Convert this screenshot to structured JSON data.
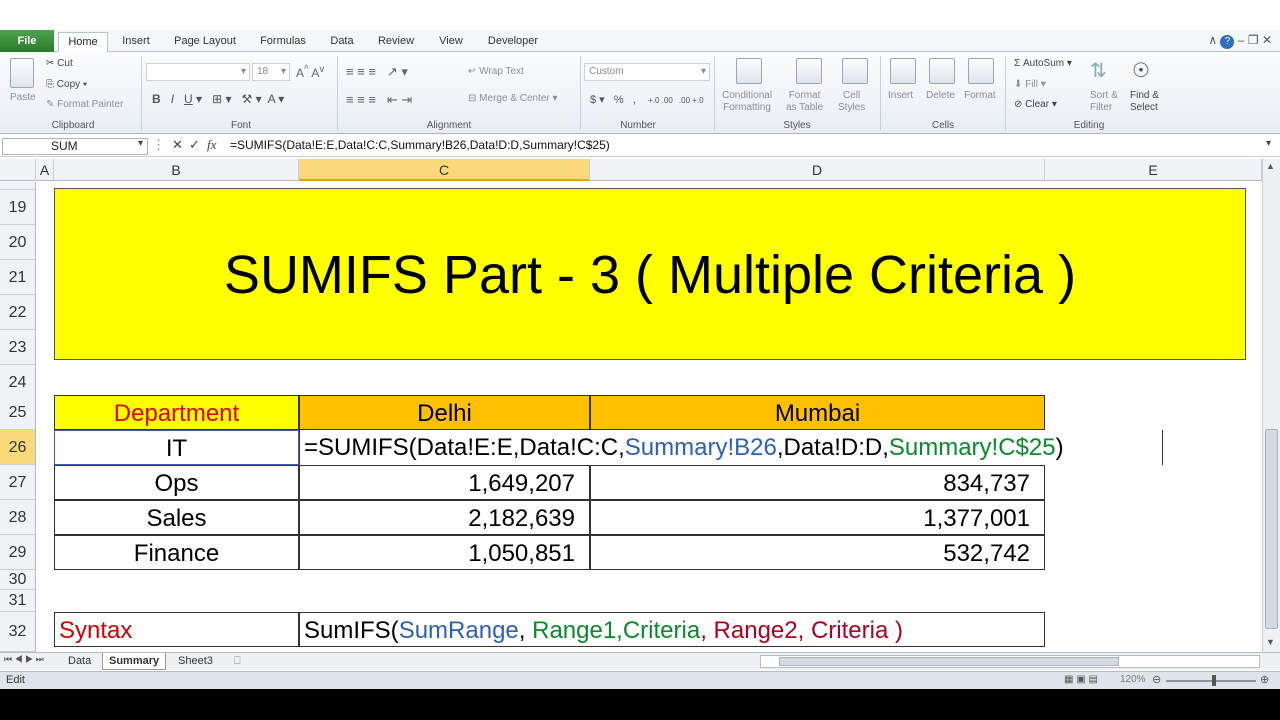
{
  "ribbon_tabs": [
    "File",
    "Home",
    "Insert",
    "Page Layout",
    "Formulas",
    "Data",
    "Review",
    "View",
    "Developer"
  ],
  "clipboard": {
    "paste": "Paste",
    "cut": "Cut",
    "copy": "Copy",
    "format_painter": "Format Painter",
    "label": "Clipboard"
  },
  "font": {
    "size": "18",
    "label": "Font"
  },
  "alignment": {
    "wrap": "Wrap Text",
    "merge": "Merge & Center",
    "label": "Alignment"
  },
  "number": {
    "format": "Custom",
    "label": "Number"
  },
  "styles": {
    "cond": "Conditional\nFormatting",
    "fmt_table": "Format\nas Table",
    "cell_styles": "Cell\nStyles",
    "label": "Styles"
  },
  "cells": {
    "insert": "Insert",
    "delete": "Delete",
    "format": "Format",
    "label": "Cells"
  },
  "editing": {
    "autosum": "AutoSum",
    "fill": "Fill",
    "clear": "Clear",
    "sort": "Sort &\nFilter",
    "find": "Find &\nSelect",
    "label": "Editing"
  },
  "formula_bar": {
    "name_box": "SUM",
    "formula": "=SUMIFS(Data!E:E,Data!C:C,Summary!B26,Data!D:D,Summary!C$25)"
  },
  "columns": [
    "A",
    "B",
    "C",
    "D",
    "E"
  ],
  "rows": [
    "19",
    "20",
    "21",
    "22",
    "23",
    "24",
    "25",
    "26",
    "27",
    "28",
    "29",
    "30",
    "31",
    "32"
  ],
  "banner": "SUMIFS Part - 3 ( Multiple Criteria )",
  "table": {
    "headers": [
      "Department",
      "Delhi",
      "Mumbai"
    ],
    "it_label": "IT",
    "it_formula": {
      "p1": "=SUMIFS(Data!E:E,Data!C:C,",
      "p2": "Summary!B26",
      "p3": ",Data!D:D,",
      "p4": "Summary!C$25",
      ")": ")"
    },
    "rows": [
      {
        "dept": "Ops",
        "delhi": "1,649,207",
        "mumbai": "834,737"
      },
      {
        "dept": "Sales",
        "delhi": "2,182,639",
        "mumbai": "1,377,001"
      },
      {
        "dept": "Finance",
        "delhi": "1,050,851",
        "mumbai": "532,742"
      }
    ]
  },
  "syntax": {
    "label": "Syntax",
    "fn": "SumIFS(",
    "sum_range": "SumRange",
    "c1": ", ",
    "range1": "Range1,Criteria",
    "c2": ", ",
    "range2": "Range2, Criteria",
    ")": " )"
  },
  "sheets": [
    "Data",
    "Summary",
    "Sheet3"
  ],
  "status": {
    "mode": "Edit",
    "zoom": "120%"
  }
}
